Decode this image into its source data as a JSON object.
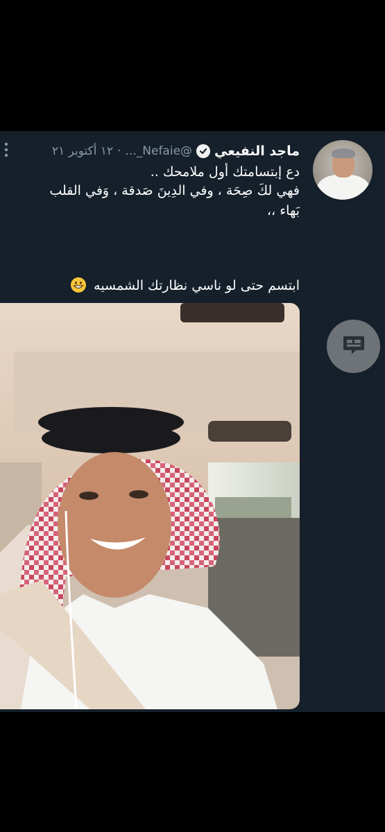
{
  "tweet": {
    "display_name": "ماجد النفيعي",
    "handle": "@Nefaie_...",
    "separator": "·",
    "date": "١٢ أكتوبر ٢١",
    "text_lines": [
      "دع إبتسامتك أول ملامحك ..",
      "فهي لكَ صِحَة ، وفي الدِينَ صَدقة ، وَفي القلب",
      "بَهاء ،،"
    ],
    "caption": "ابتسم حتى لو ناسي نظارتك الشمسيه",
    "caption_emoji": "grinning-face-emoji",
    "verified_icon": "verified-badge-icon",
    "more_icon": "more-vertical-icon"
  },
  "actions": {
    "reply_icon": "comment-bubble-icon"
  },
  "colors": {
    "background": "#000000",
    "card": "#15202b",
    "secondary_text": "#8899a6",
    "button": "#6e7378"
  }
}
